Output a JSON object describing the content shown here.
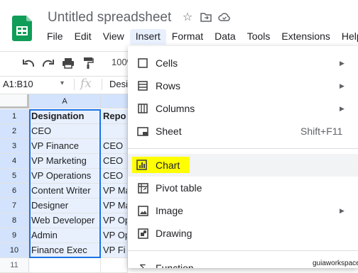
{
  "app": {
    "title": "Untitled spreadsheet"
  },
  "menubar": {
    "items": [
      "File",
      "Edit",
      "View",
      "Insert",
      "Format",
      "Data",
      "Tools",
      "Extensions",
      "Help"
    ]
  },
  "toolbar": {
    "zoom": "100%"
  },
  "formula_bar": {
    "name_box": "A1:B10",
    "fx": "fx",
    "content": "Designation"
  },
  "grid": {
    "columns": [
      "A"
    ],
    "rows": [
      "1",
      "2",
      "3",
      "4",
      "5",
      "6",
      "7",
      "8",
      "9",
      "10",
      "11"
    ],
    "colA": [
      "Designation",
      "CEO",
      "VP Finance",
      "VP Marketing",
      "VP Operations",
      "Content Writer",
      "Designer",
      "Web Developer",
      "Admin",
      "Finance Exec",
      ""
    ],
    "colB": [
      "Repo",
      "",
      "CEO",
      "CEO",
      "CEO",
      "VP Ma",
      "VP Ma",
      "VP Op",
      "VP Op",
      "VP Fi",
      ""
    ]
  },
  "insert_menu": {
    "items": [
      {
        "label": "Cells",
        "icon": "cells-icon",
        "submenu": true
      },
      {
        "label": "Rows",
        "icon": "rows-icon",
        "submenu": true
      },
      {
        "label": "Columns",
        "icon": "columns-icon",
        "submenu": true
      },
      {
        "label": "Sheet",
        "icon": "sheet-icon",
        "shortcut": "Shift+F11"
      },
      {
        "label": "Chart",
        "icon": "chart-icon",
        "highlight": "#ffff00"
      },
      {
        "label": "Pivot table",
        "icon": "pivot-table-icon"
      },
      {
        "label": "Image",
        "icon": "image-icon",
        "submenu": true
      },
      {
        "label": "Drawing",
        "icon": "drawing-icon"
      },
      {
        "label": "Function",
        "icon": "function-icon"
      }
    ]
  },
  "watermark": "guiaworkspace"
}
